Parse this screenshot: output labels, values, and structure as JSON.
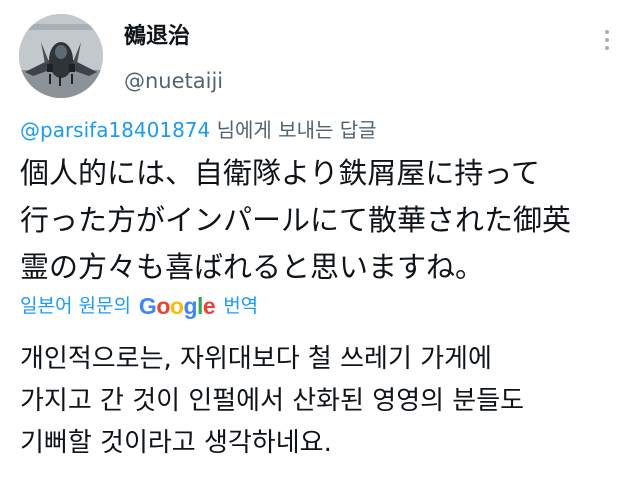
{
  "author": {
    "display_name": "鵺退治",
    "handle": "@nuetaiji"
  },
  "reply_context": {
    "mention": "@parsifa18401874",
    "suffix": "님에게 보내는 답글"
  },
  "tweet": {
    "lines": [
      "個人的には、自衛隊より鉄屑屋に持って",
      "行った方がインパールにて散華された御英",
      "霊の方々も喜ばれると思いますね。"
    ]
  },
  "translation": {
    "prefix": "일본어 원문의",
    "google": [
      "G",
      "o",
      "o",
      "g",
      "l",
      "e"
    ],
    "suffix": "번역",
    "lines": [
      "개인적으로는, 자위대보다 철 쓰레기 가게에",
      "가지고 간 것이 인펄에서 산화된 영영의 분들도",
      "기뻐할 것이라고 생각하네요."
    ]
  },
  "icons": {
    "more": "more-vertical-icon",
    "avatar_image": "fighter-jet-image"
  },
  "colors": {
    "link": "#1d9bf0",
    "secondary_text": "#536471",
    "primary_text": "#0f1419"
  }
}
